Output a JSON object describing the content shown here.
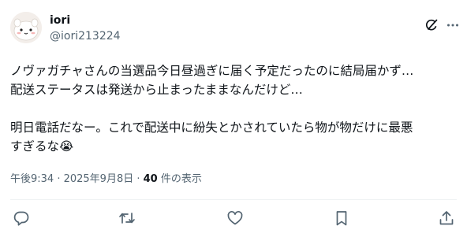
{
  "author": {
    "display_name": "iori",
    "handle": "@iori213224",
    "avatar_icon": "white-mascot-avatar"
  },
  "header_icons": [
    "grok-icon",
    "more-options-icon"
  ],
  "tweet": {
    "lines": [
      "ノヴァガチャさんの当選品今日昼過ぎに届く予定だったのに結局届かず…",
      "配送ステータスは発送から止まったままなんだけど…",
      "明日電話だなー。これで配送中に紛失とかされていたら物が物だけに最悪",
      "すぎるな😭"
    ]
  },
  "meta": {
    "timestamp": "午後9:34 · 2025年9月8日 ·",
    "views_count": "40",
    "views_label": "件の表示"
  },
  "actions": [
    "reply-icon",
    "retweet-icon",
    "like-icon",
    "bookmark-icon",
    "share-icon"
  ],
  "colors": {
    "text_primary": "#0f1419",
    "text_secondary": "#536471",
    "divider": "#eff3f4"
  }
}
